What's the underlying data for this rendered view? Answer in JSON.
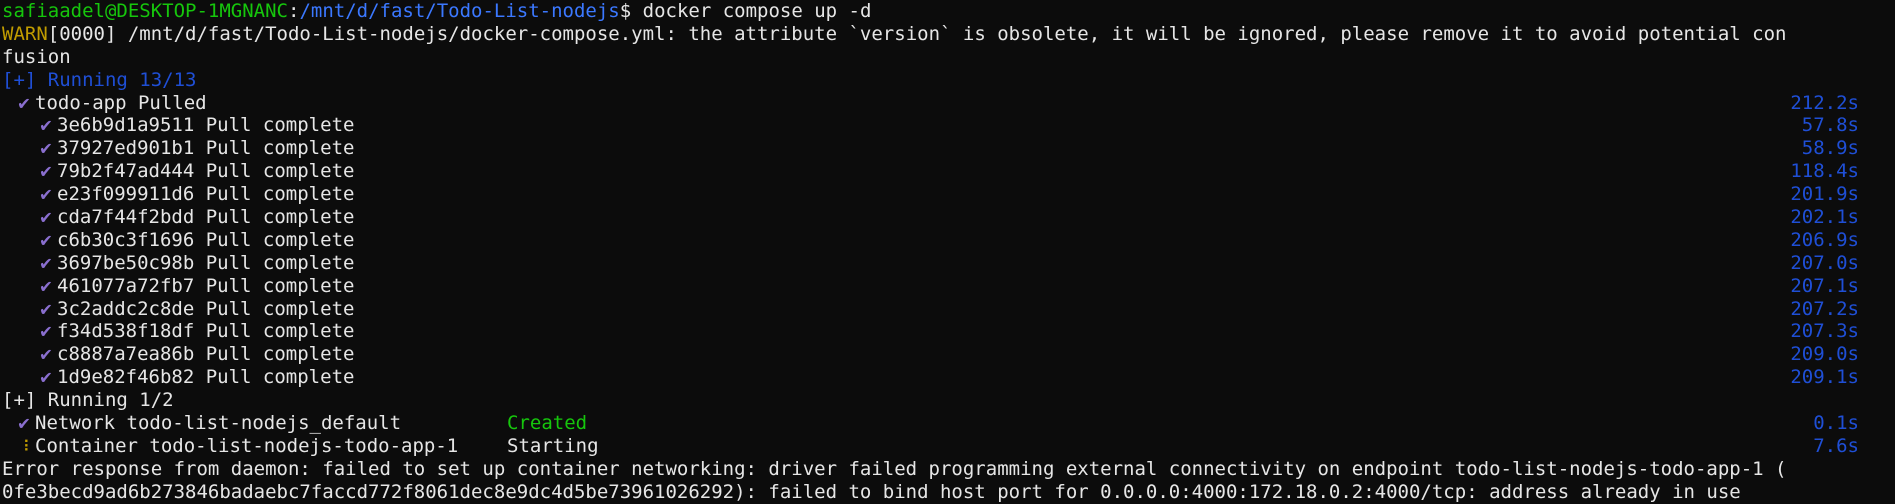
{
  "prompt": {
    "user_host": "safiaadel@DESKTOP-1MGNANC",
    "path": "/mnt/d/fast/Todo-List-nodejs",
    "symbol": "$",
    "command": " docker compose up -d"
  },
  "warn": {
    "tag": "WARN",
    "text": "[0000] /mnt/d/fast/Todo-List-nodejs/docker-compose.yml: the attribute `version` is obsolete, it will be ignored, please remove it to avoid potential con",
    "wrap": "fusion"
  },
  "running1": {
    "label": "[+] Running 13/13"
  },
  "todo_app": {
    "label": "todo-app Pulled",
    "time": "212.2s"
  },
  "layers": [
    {
      "id": "3e6b9d1a9511",
      "status": "Pull complete",
      "time": "57.8s"
    },
    {
      "id": "37927ed901b1",
      "status": "Pull complete",
      "time": "58.9s"
    },
    {
      "id": "79b2f47ad444",
      "status": "Pull complete",
      "time": "118.4s"
    },
    {
      "id": "e23f099911d6",
      "status": "Pull complete",
      "time": "201.9s"
    },
    {
      "id": "cda7f44f2bdd",
      "status": "Pull complete",
      "time": "202.1s"
    },
    {
      "id": "c6b30c3f1696",
      "status": "Pull complete",
      "time": "206.9s"
    },
    {
      "id": "3697be50c98b",
      "status": "Pull complete",
      "time": "207.0s"
    },
    {
      "id": "461077a72fb7",
      "status": "Pull complete",
      "time": "207.1s"
    },
    {
      "id": "3c2addc2c8de",
      "status": "Pull complete",
      "time": "207.2s"
    },
    {
      "id": "f34d538f18df",
      "status": "Pull complete",
      "time": "207.3s"
    },
    {
      "id": "c8887a7ea86b",
      "status": "Pull complete",
      "time": "209.0s"
    },
    {
      "id": "1d9e82f46b82",
      "status": "Pull complete",
      "time": "209.1s"
    }
  ],
  "running2": {
    "label": "[+] Running 1/2"
  },
  "network": {
    "label": "Network todo-list-nodejs_default",
    "status": "Created",
    "time": "0.1s"
  },
  "container": {
    "label": "Container todo-list-nodejs-todo-app-1",
    "status": "Starting",
    "time": "7.6s"
  },
  "error": {
    "line1": "Error response from daemon: failed to set up container networking: driver failed programming external connectivity on endpoint todo-list-nodejs-todo-app-1 (",
    "line2": "0fe3becd9ad6b273846badaebc7faccd772f8061dec8e9dc4d5be73961026292): failed to bind host port for 0.0.0.0:4000:172.18.0.2:4000/tcp: address already in use"
  },
  "icons": {
    "check": "✔",
    "dot": "⠸"
  },
  "colors": {
    "background": "#0c0c0c",
    "green": "#16c60c",
    "blue": "#3b78ff",
    "yellow": "#c19c00",
    "check": "#8a6fcf"
  }
}
